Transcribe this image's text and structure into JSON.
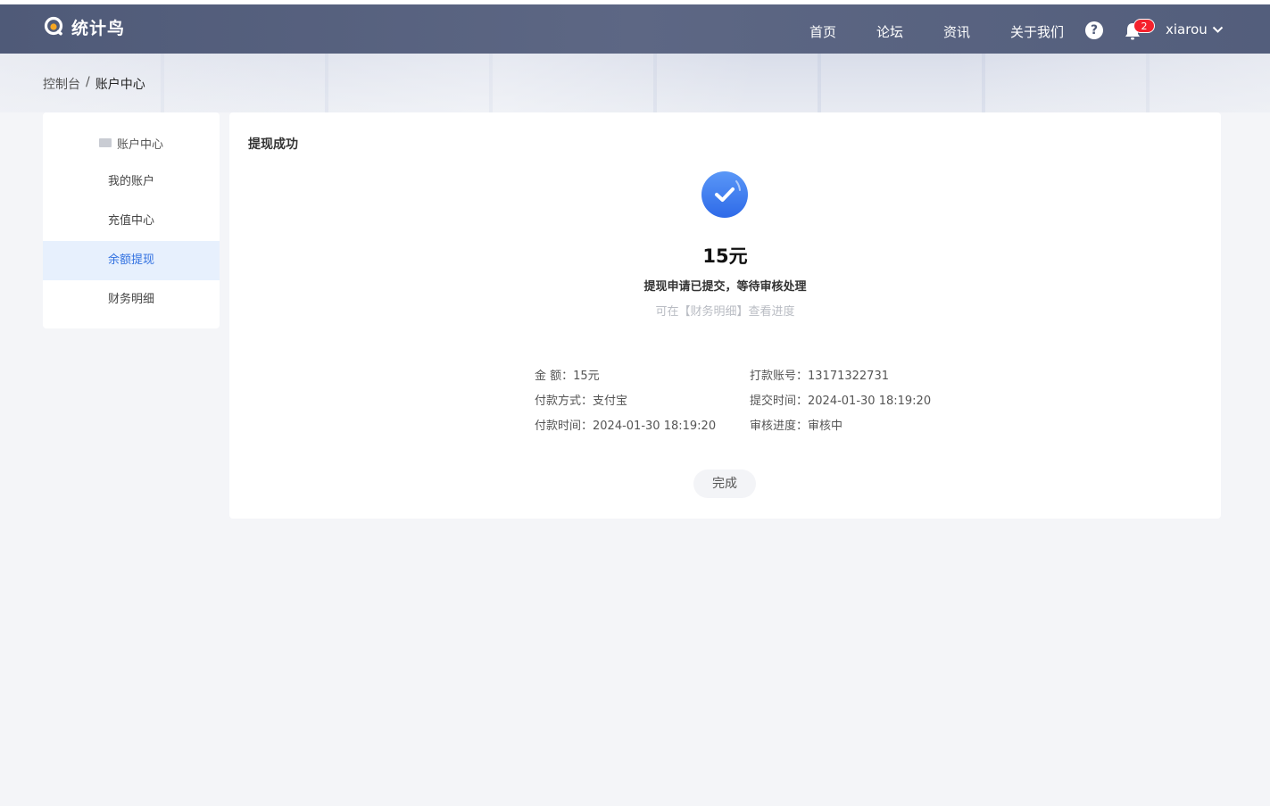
{
  "app": {
    "name": "统计鸟"
  },
  "nav": {
    "links": [
      "首页",
      "论坛",
      "资讯",
      "关于我们"
    ],
    "help": "?",
    "notification_count": "2",
    "username": "xiarou"
  },
  "breadcrumb": {
    "root": "控制台",
    "separator": "/",
    "current": "账户中心"
  },
  "sidebar": {
    "header": "账户中心",
    "items": [
      {
        "label": "我的账户",
        "active": false
      },
      {
        "label": "充值中心",
        "active": false
      },
      {
        "label": "余额提现",
        "active": true
      },
      {
        "label": "财务明细",
        "active": false
      }
    ]
  },
  "main": {
    "title": "提现成功",
    "amount": "15元",
    "message": "提现申请已提交，等待审核处理",
    "hint": "可在【财务明细】查看进度",
    "details": {
      "amount": {
        "label": "金 额：",
        "value": "15元"
      },
      "pay_method": {
        "label": "付款方式：",
        "value": "支付宝"
      },
      "pay_time": {
        "label": "付款时间：",
        "value": "2024-01-30 18:19:20"
      },
      "account": {
        "label": "打款账号：",
        "value": "13171322731"
      },
      "submit_time": {
        "label": "提交时间：",
        "value": "2024-01-30 18:19:20"
      },
      "review": {
        "label": "审核进度：",
        "value": "审核中"
      }
    },
    "done_label": "完成"
  },
  "colors": {
    "navbar": "#535e7c",
    "accent": "#2f6fe0",
    "active_bg": "#e7f0fd",
    "badge": "#f5222d",
    "success": "#3d7cf0"
  }
}
